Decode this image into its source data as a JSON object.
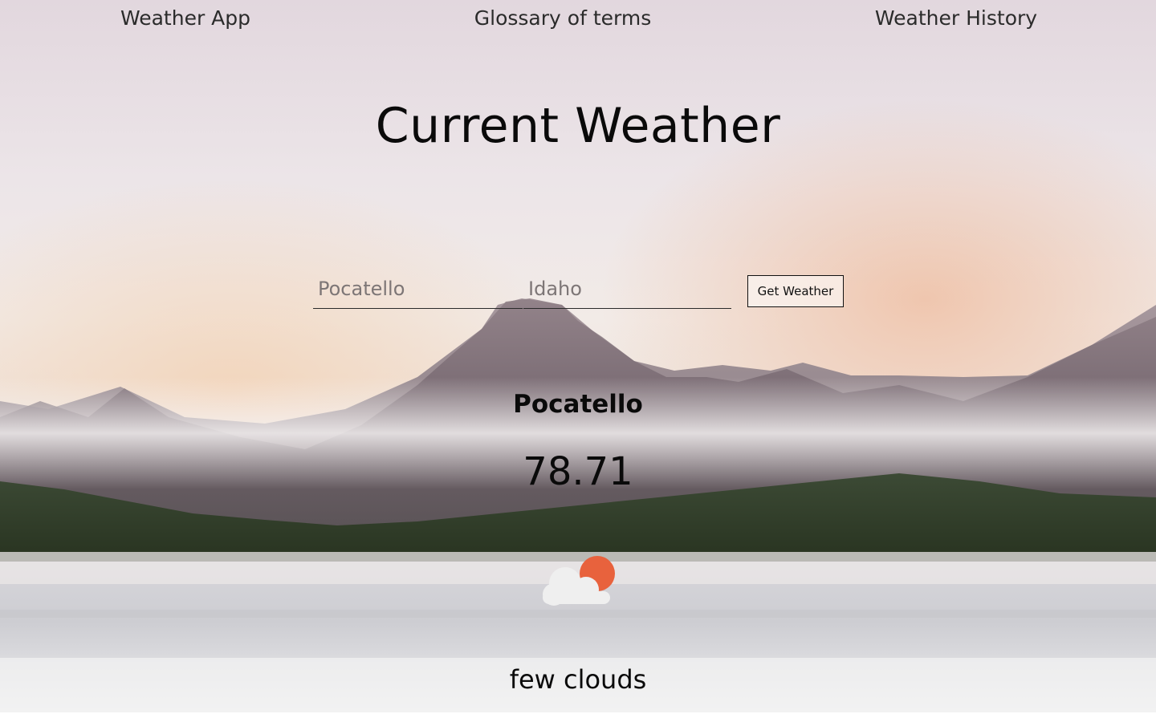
{
  "nav": {
    "app_label": "Weather App",
    "glossary_label": "Glossary of terms",
    "history_label": "Weather History"
  },
  "title": "Current Weather",
  "form": {
    "city_placeholder": "Pocatello",
    "state_placeholder": "Idaho",
    "submit_label": "Get Weather"
  },
  "result": {
    "city": "Pocatello",
    "temperature": "78.71",
    "description": "few clouds",
    "icon": "few-clouds-icon"
  },
  "colors": {
    "sun": "#e8623d",
    "cloud": "#efefef",
    "text": "#0a0a0a"
  }
}
